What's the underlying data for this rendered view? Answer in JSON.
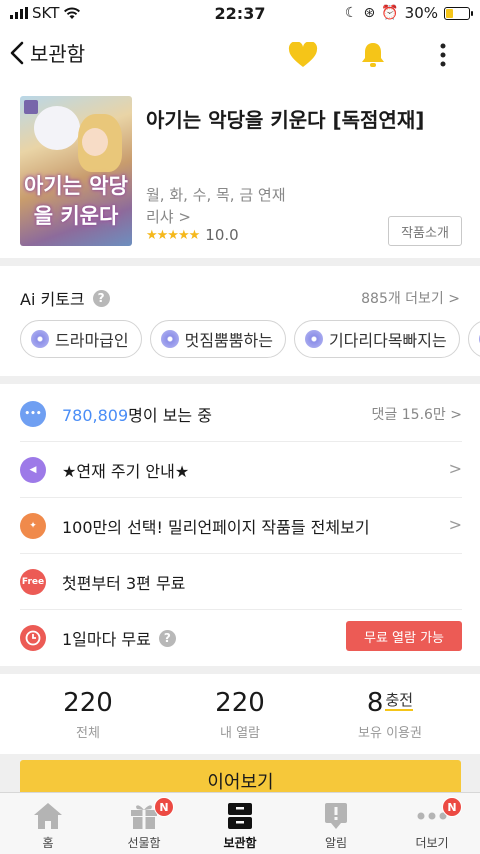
{
  "status_bar": {
    "carrier": "SKT",
    "time": "22:37",
    "battery": "30%",
    "battery_level": 0.3
  },
  "header": {
    "title": "보관함",
    "icons": [
      "back-chevron-icon",
      "heart-icon",
      "bell-icon",
      "more-vertical-icon"
    ],
    "accent": "#f5c518"
  },
  "work": {
    "cover_title": "아기는 악당을 키운다",
    "title": "아기는 악당을 키운다 [독점연재]",
    "schedule": "월, 화, 수, 목, 금 연재",
    "author": "리샤 >",
    "rating": "10.0",
    "stars": "★★★★★",
    "intro_button": "작품소개"
  },
  "keywords": {
    "label": "Ai 키토크",
    "help": "?",
    "more": "885개 더보기 >",
    "chips": [
      "드라마급인",
      "멋짐뿜뿜하는",
      "기다리다목빠지는"
    ]
  },
  "list": {
    "viewers_count": "780,809",
    "viewers_suffix": "명이 보는 중",
    "comments": "댓글 15.6만 >",
    "notice": "★연재 주기 안내★",
    "event": "100만의 선택! 밀리언페이지 작품들 전체보기",
    "free_badge": "Free",
    "free_first": "첫편부터 3편 무료",
    "daily_free": "1일마다 무료",
    "daily_help": "?",
    "free_button": "무료 열람 가능",
    "chevron": ">"
  },
  "stats": [
    {
      "value": "220",
      "label": "전체"
    },
    {
      "value": "220",
      "label": "내 열람"
    },
    {
      "value": "8",
      "label": "보유 이용권",
      "action": "충전"
    }
  ],
  "continue_button": "이어보기",
  "tabs": [
    {
      "label": "홈",
      "icon": "home-icon"
    },
    {
      "label": "선물함",
      "icon": "gift-icon",
      "badge": "N"
    },
    {
      "label": "보관함",
      "icon": "library-icon",
      "active": true
    },
    {
      "label": "알림",
      "icon": "notification-icon"
    },
    {
      "label": "더보기",
      "icon": "more-dots-icon",
      "badge": "N"
    }
  ],
  "colors": {
    "accent_yellow": "#f6c83a",
    "link_blue": "#4a8df6",
    "alert_red": "#ec5b55"
  }
}
